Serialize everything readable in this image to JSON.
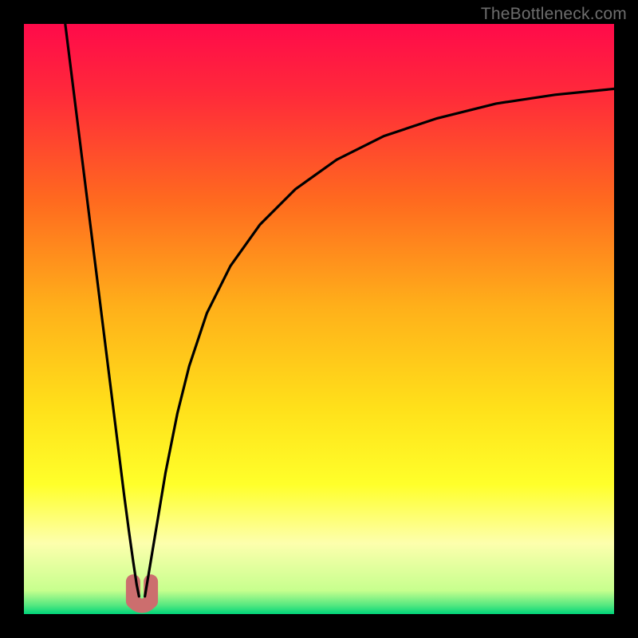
{
  "watermark": "TheBottleneck.com",
  "chart_data": {
    "type": "line",
    "title": "",
    "xlabel": "",
    "ylabel": "",
    "xlim": [
      0,
      100
    ],
    "ylim": [
      0,
      100
    ],
    "grid": false,
    "legend": false,
    "background_gradient": {
      "stops": [
        {
          "offset": 0.0,
          "color": "#ff0a4a"
        },
        {
          "offset": 0.12,
          "color": "#ff2a3a"
        },
        {
          "offset": 0.3,
          "color": "#ff6a1f"
        },
        {
          "offset": 0.48,
          "color": "#ffb01a"
        },
        {
          "offset": 0.65,
          "color": "#ffe01a"
        },
        {
          "offset": 0.78,
          "color": "#ffff2a"
        },
        {
          "offset": 0.88,
          "color": "#fdffad"
        },
        {
          "offset": 0.96,
          "color": "#c7ff8e"
        },
        {
          "offset": 0.985,
          "color": "#55e880"
        },
        {
          "offset": 1.0,
          "color": "#00d47a"
        }
      ]
    },
    "bump": {
      "x_center": 20,
      "y_top": 94,
      "color": "#cc6e6e"
    },
    "series": [
      {
        "name": "left-branch",
        "x": [
          7,
          8,
          9,
          10,
          11,
          12,
          13,
          14,
          15,
          16,
          17,
          17.8,
          18.5,
          19.1,
          19.5
        ],
        "y": [
          100,
          92,
          84,
          76,
          68,
          60,
          52,
          44,
          36,
          28,
          20,
          14,
          9,
          5,
          3
        ]
      },
      {
        "name": "right-branch",
        "x": [
          20.5,
          21,
          22,
          23,
          24,
          26,
          28,
          31,
          35,
          40,
          46,
          53,
          61,
          70,
          80,
          90,
          100
        ],
        "y": [
          3,
          6,
          12,
          18,
          24,
          34,
          42,
          51,
          59,
          66,
          72,
          77,
          81,
          84,
          86.5,
          88,
          89
        ]
      }
    ]
  }
}
